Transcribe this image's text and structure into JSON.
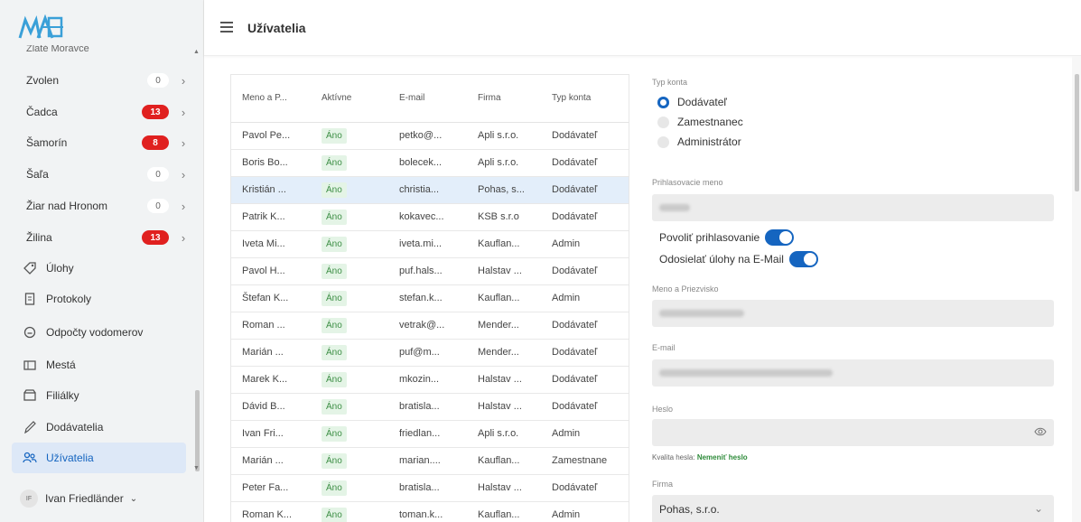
{
  "header": {
    "title": "Užívatelia"
  },
  "sidebar": {
    "cut_item": "Zlaté Moravce",
    "cities": [
      {
        "name": "Zvolen",
        "count": "0",
        "alert": false
      },
      {
        "name": "Čadca",
        "count": "13",
        "alert": true
      },
      {
        "name": "Šamorín",
        "count": "8",
        "alert": true
      },
      {
        "name": "Šaľa",
        "count": "0",
        "alert": false
      },
      {
        "name": "Žiar nad Hronom",
        "count": "0",
        "alert": false
      },
      {
        "name": "Žilina",
        "count": "13",
        "alert": true
      }
    ],
    "nav": [
      {
        "label": "Úlohy",
        "icon": "tag-icon"
      },
      {
        "label": "Protokoly",
        "icon": "document-icon"
      },
      {
        "label": "Odpočty vodomerov",
        "icon": "gauge-icon"
      },
      {
        "label": "Mestá",
        "icon": "city-icon"
      },
      {
        "label": "Filiálky",
        "icon": "branch-icon"
      },
      {
        "label": "Dodávatelia",
        "icon": "pen-icon"
      },
      {
        "label": "Užívatelia",
        "icon": "users-icon",
        "active": true
      }
    ],
    "user": {
      "initials": "IF",
      "name": "Ivan Friedländer"
    }
  },
  "table": {
    "headers": [
      "Meno a P...",
      "Aktívne",
      "E-mail",
      "Firma",
      "Typ konta"
    ],
    "rows": [
      [
        "Pavol Pe...",
        "Áno",
        "petko@...",
        "Apli s.r.o.",
        "Dodávateľ"
      ],
      [
        "Boris Bo...",
        "Áno",
        "bolecek...",
        "Apli s.r.o.",
        "Dodávateľ"
      ],
      [
        "Kristián ...",
        "Áno",
        "christia...",
        "Pohas, s...",
        "Dodávateľ"
      ],
      [
        "Patrik K...",
        "Áno",
        "kokavec...",
        "KSB s.r.o",
        "Dodávateľ"
      ],
      [
        "Iveta Mi...",
        "Áno",
        "iveta.mi...",
        "Kauflan...",
        "Admin"
      ],
      [
        "Pavol H...",
        "Áno",
        "puf.hals...",
        "Halstav ...",
        "Dodávateľ"
      ],
      [
        "Štefan K...",
        "Áno",
        "stefan.k...",
        "Kauflan...",
        "Admin"
      ],
      [
        "Roman ...",
        "Áno",
        "vetrak@...",
        "Mender...",
        "Dodávateľ"
      ],
      [
        "Marián ...",
        "Áno",
        "puf@m...",
        "Mender...",
        "Dodávateľ"
      ],
      [
        "Marek K...",
        "Áno",
        "mkozin...",
        "Halstav ...",
        "Dodávateľ"
      ],
      [
        "Dávid B...",
        "Áno",
        "bratisla...",
        "Halstav ...",
        "Dodávateľ"
      ],
      [
        "Ivan Fri...",
        "Áno",
        "friedlan...",
        "Apli s.r.o.",
        "Admin"
      ],
      [
        "Marián ...",
        "Áno",
        "marian....",
        "Kauflan...",
        "Zamestnane"
      ],
      [
        "Peter Fa...",
        "Áno",
        "bratisla...",
        "Halstav ...",
        "Dodávateľ"
      ],
      [
        "Roman K...",
        "Áno",
        "toman.k...",
        "Kauflan...",
        "Admin"
      ]
    ],
    "selected_row": 2
  },
  "form": {
    "account_type_label": "Typ konta",
    "account_types": [
      "Dodávateľ",
      "Zamestnanec",
      "Administrátor"
    ],
    "account_type_selected": "Dodávateľ",
    "login_label": "Prihlasovacie meno",
    "allow_login_label": "Povoliť prihlasovanie",
    "allow_login": true,
    "send_tasks_label": "Odosielať úlohy na E-Mail",
    "send_tasks": true,
    "name_label": "Meno a Priezvisko",
    "email_label": "E-mail",
    "password_label": "Heslo",
    "password_quality_label": "Kvalita hesla:",
    "password_quality_value": "Nemeniť heslo",
    "company_label": "Firma",
    "company_value": "Pohas, s.r.o."
  }
}
